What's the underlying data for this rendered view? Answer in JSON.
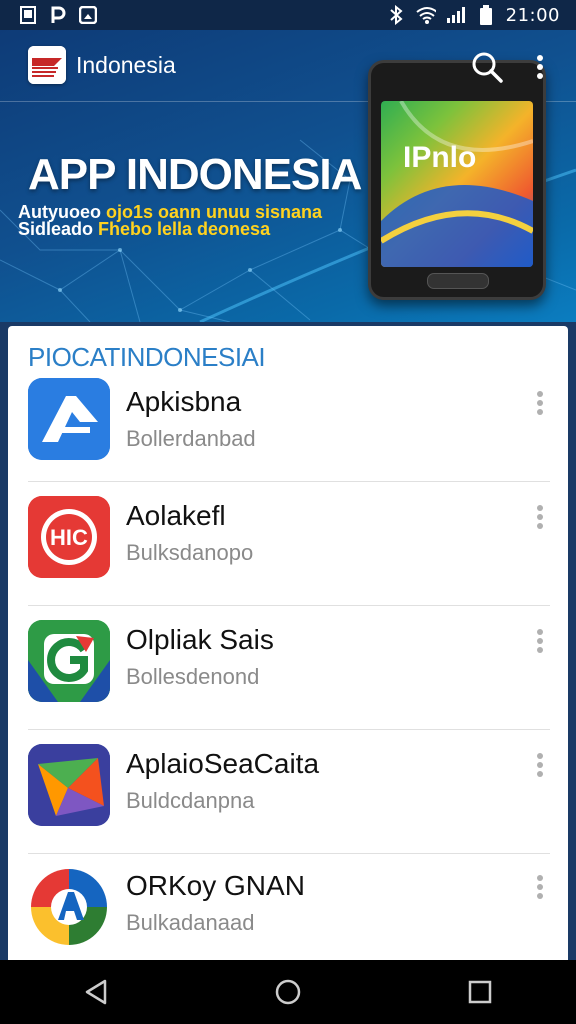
{
  "status_bar": {
    "time": "21:00",
    "left_icons": [
      "image-icon",
      "parking-icon",
      "gallery-icon"
    ],
    "right_icons": [
      "bluetooth-icon",
      "wifi-icon",
      "signal-icon",
      "battery-icon"
    ]
  },
  "app_bar": {
    "title": "Indonesia",
    "logo_icon": "flag-logo-icon",
    "search_icon": "search-icon",
    "more_icon": "more-vert-icon"
  },
  "hero": {
    "title": "APP INDONESIA",
    "subtitle_line1_white": "Autyuoeo",
    "subtitle_line1_yellow": "ojo1s oann unuu sisnana",
    "subtitle_line2_white": "Sidleado",
    "subtitle_line2_yellow": "Fhebo lella deonesa",
    "phone_screen_text": "IPnlo"
  },
  "section": {
    "title": "PIOCATINDONESIAI"
  },
  "apps": [
    {
      "name": "Apkisbna",
      "subtitle": "Bollerdanbad",
      "icon": "a-arrow-icon",
      "color": "#2a7de1"
    },
    {
      "name": "Aolakefl",
      "subtitle": "Bulksdanopo",
      "icon": "hic-circle-icon",
      "color": "#e53935"
    },
    {
      "name": "Olpliak Sais",
      "subtitle": "Bollesdenond",
      "icon": "g-arrow-icon",
      "color": "#2e9b46"
    },
    {
      "name": "AplaioSeaCaita",
      "subtitle": "Buldcdanpna",
      "icon": "origami-star-icon",
      "color": "#2d4fa8"
    },
    {
      "name": "ORKoy GNAN",
      "subtitle": "Bulkadanaad",
      "icon": "colorful-a-logo-icon",
      "color": "#1565c0"
    }
  ],
  "nav": {
    "back_icon": "back-triangle-icon",
    "home_icon": "home-circle-icon",
    "recents_icon": "recents-square-icon"
  }
}
